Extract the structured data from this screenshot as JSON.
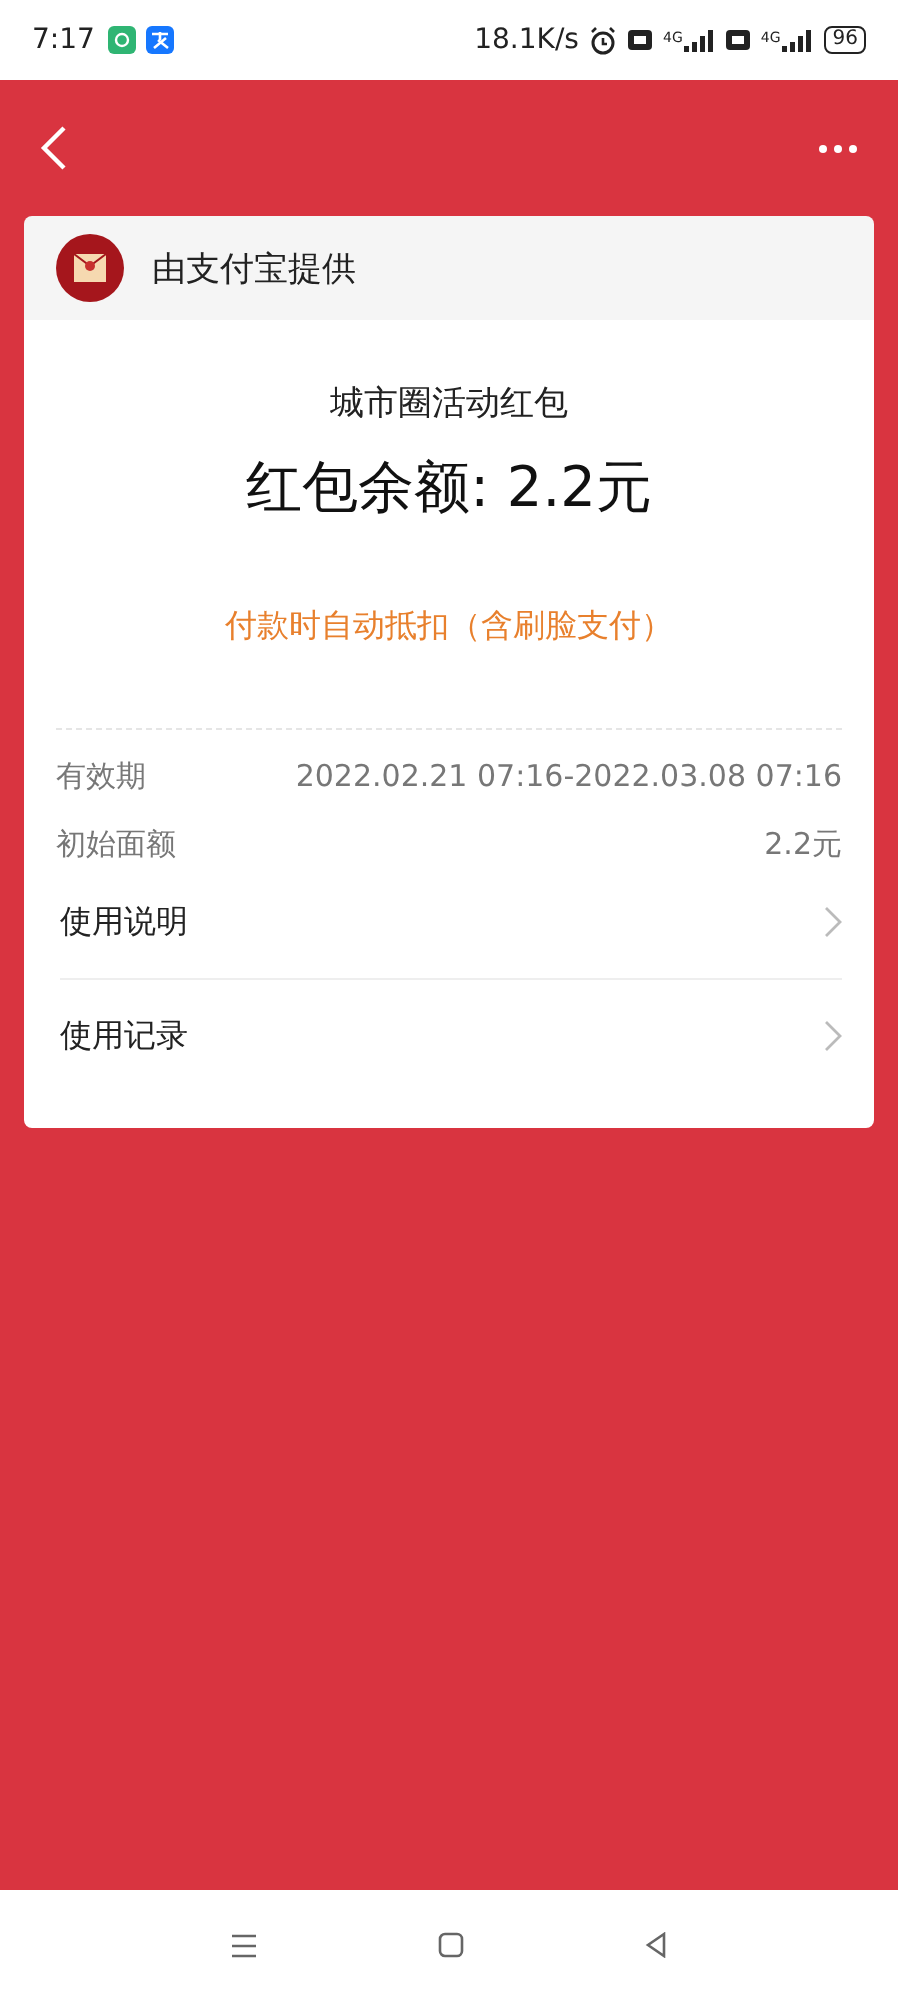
{
  "status_bar": {
    "time": "7:17",
    "speed": "18.1K/s",
    "network_labels": [
      "4G",
      "4G"
    ],
    "battery": "96"
  },
  "card": {
    "provider": "由支付宝提供",
    "title": "城市圈活动红包",
    "balance": "红包余额: 2.2元",
    "note": "付款时自动抵扣（含刷脸支付）",
    "details": [
      {
        "label": "有效期",
        "value": "2022.02.21 07:16-2022.03.08 07:16"
      },
      {
        "label": "初始面额",
        "value": "2.2元"
      }
    ],
    "links": [
      {
        "label": "使用说明"
      },
      {
        "label": "使用记录"
      }
    ]
  }
}
